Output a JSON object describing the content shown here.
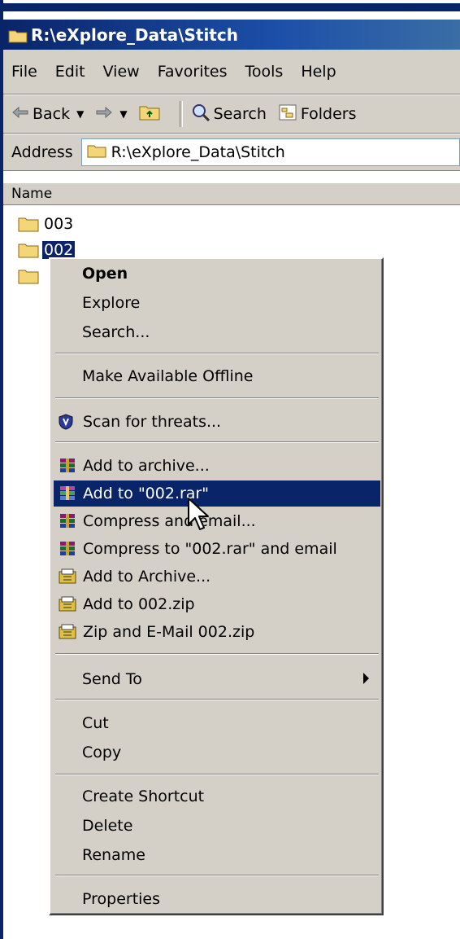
{
  "window": {
    "title": "R:\\eXplore_Data\\Stitch"
  },
  "menubar": {
    "items": [
      "File",
      "Edit",
      "View",
      "Favorites",
      "Tools",
      "Help"
    ]
  },
  "toolbar": {
    "back": "Back",
    "search": "Search",
    "folders": "Folders"
  },
  "address": {
    "label": "Address",
    "value": "R:\\eXplore_Data\\Stitch"
  },
  "list": {
    "column": "Name",
    "files": [
      {
        "name": "003",
        "selected": false
      },
      {
        "name": "002",
        "selected": true
      },
      {
        "name": "",
        "selected": false
      }
    ]
  },
  "context_menu": {
    "open": "Open",
    "explore": "Explore",
    "search": "Search...",
    "offline": "Make Available Offline",
    "scan": "Scan for threats...",
    "add_archive": "Add to archive...",
    "add_rar": "Add to \"002.rar\"",
    "compress_email": "Compress and email...",
    "compress_rar_email": "Compress to \"002.rar\" and email",
    "add_Archive_zip": "Add to Archive...",
    "add_zip": "Add to 002.zip",
    "zip_email": "Zip and E-Mail 002.zip",
    "send_to": "Send To",
    "cut": "Cut",
    "copy": "Copy",
    "create_shortcut": "Create Shortcut",
    "delete": "Delete",
    "rename": "Rename",
    "properties": "Properties",
    "highlighted": "add_rar"
  },
  "colors": {
    "selection": "#0a246a",
    "chrome": "#d4d0c8",
    "folder": "#f5d57a"
  }
}
